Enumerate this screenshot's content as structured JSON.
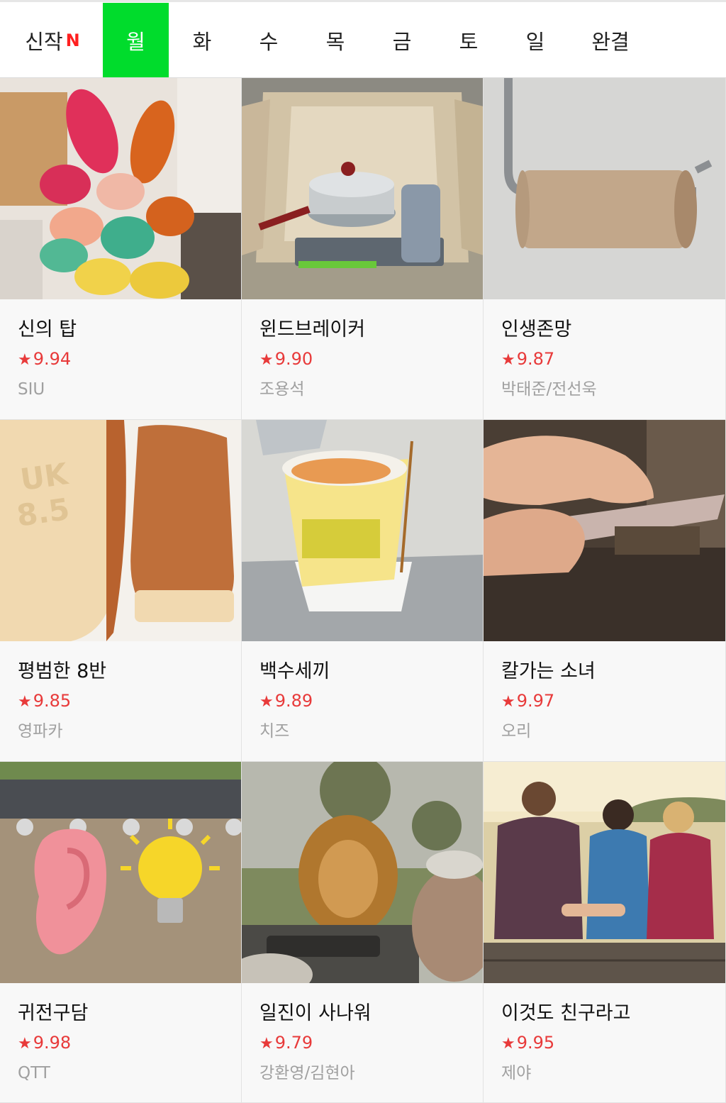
{
  "tabs": {
    "new_label": "신작",
    "new_badge": "N",
    "days": [
      "월",
      "화",
      "수",
      "목",
      "금",
      "토",
      "일",
      "완결"
    ],
    "active_day": "월"
  },
  "colors": {
    "active_tab": "#00dc2c",
    "rating": "#e83a3a",
    "new_badge": "#ff2020"
  },
  "webtoons": [
    {
      "title": "신의 탑",
      "rating": "9.94",
      "author": "SIU",
      "thumbnail": "ballet-flats-in-boxes"
    },
    {
      "title": "윈드브레이커",
      "rating": "9.90",
      "author": "조용석",
      "thumbnail": "pot-on-camping-stove"
    },
    {
      "title": "인생존망",
      "rating": "9.87",
      "author": "박태준/전선욱",
      "thumbnail": "empty-toilet-paper-roll"
    },
    {
      "title": "평범한 8반",
      "rating": "9.85",
      "author": "영파카",
      "thumbnail": "brown-boots-uk-8-5"
    },
    {
      "title": "백수세끼",
      "rating": "9.89",
      "author": "치즈",
      "thumbnail": "instant-noodle-cup"
    },
    {
      "title": "칼가는 소녀",
      "rating": "9.97",
      "author": "오리",
      "thumbnail": "knife-sharpening"
    },
    {
      "title": "귀전구담",
      "rating": "9.98",
      "author": "QTT",
      "thumbnail": "ear-and-lightbulb-wall"
    },
    {
      "title": "일진이 사나워",
      "rating": "9.79",
      "author": "강환영/김현아",
      "thumbnail": "lion-safari"
    },
    {
      "title": "이것도 친구라고",
      "rating": "9.95",
      "author": "제야",
      "thumbnail": "friends-on-dock"
    }
  ]
}
